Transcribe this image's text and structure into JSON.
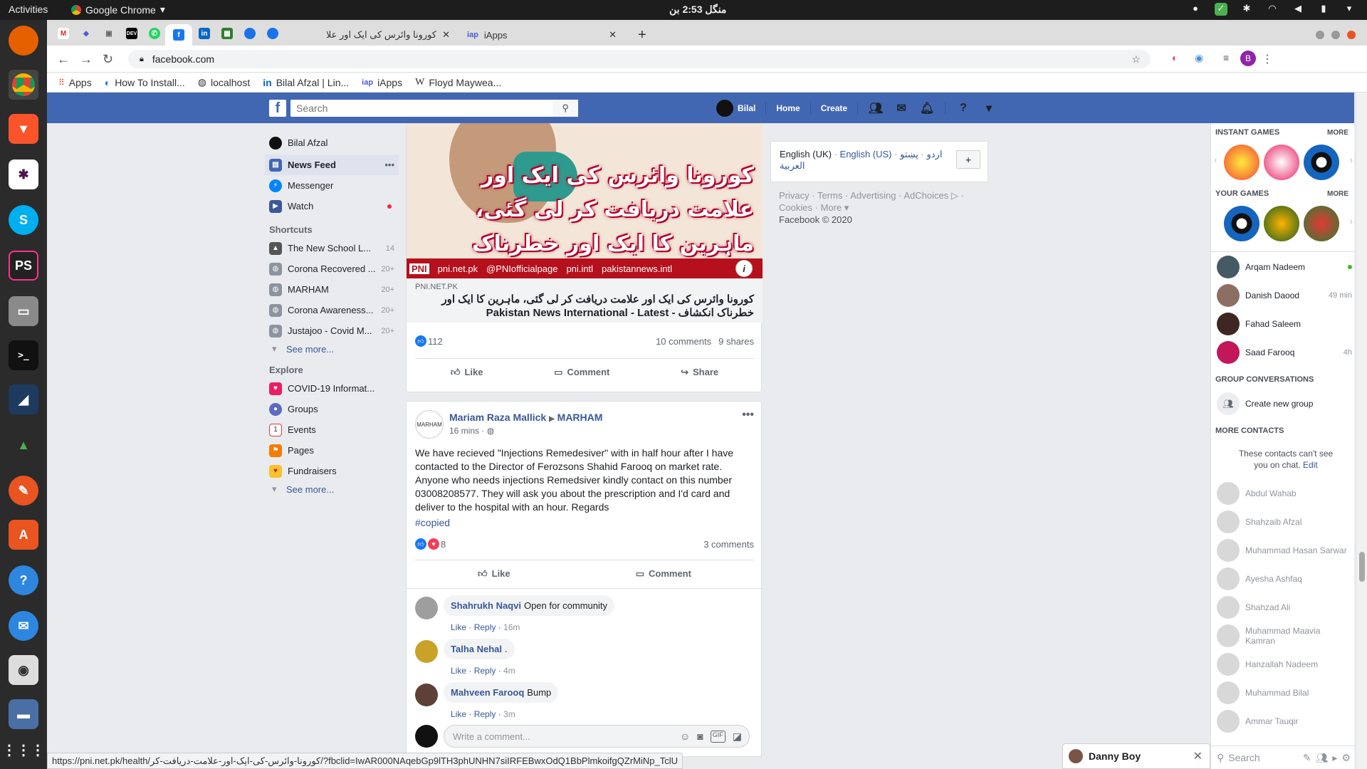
{
  "os": {
    "activities": "Activities",
    "app_name": "Google Chrome",
    "clock": "منگل 2:53 بن"
  },
  "browser": {
    "tabs": [
      {
        "title": "کورونا وائرس کی ایک اور علا",
        "active": true
      },
      {
        "title": "iApps",
        "active": false
      }
    ],
    "url": "facebook.com",
    "bookmarks": [
      {
        "label": "Apps",
        "icon": "apps-grid-icon"
      },
      {
        "label": "How To Install...",
        "icon": "bookmark-icon"
      },
      {
        "label": "localhost",
        "icon": "globe-icon"
      },
      {
        "label": "Bilal Afzal | Lin...",
        "icon": "linkedin-icon"
      },
      {
        "label": "iApps",
        "icon": "iapps-icon"
      },
      {
        "label": "Floyd Maywea...",
        "icon": "wikipedia-icon"
      }
    ],
    "profile_initial": "B",
    "status_url": "https://pni.net.pk/health/کورونا-وائرس-کی-ایک-اور-علامت-دریافت-کر/?fbclid=IwAR000NAqebGp9lTH3phUNHN7siIRFEBwxOdQ1BbPlmkoifgQZrMiNp_TclU"
  },
  "fb": {
    "search_placeholder": "Search",
    "header": {
      "user": "Bilal",
      "home": "Home",
      "create": "Create"
    },
    "leftnav": {
      "user": "Bilal Afzal",
      "main": [
        {
          "label": "News Feed",
          "selected": true
        },
        {
          "label": "Messenger"
        },
        {
          "label": "Watch"
        }
      ],
      "shortcuts_head": "Shortcuts",
      "shortcuts": [
        {
          "label": "The New School L...",
          "count": "14"
        },
        {
          "label": "Corona Recovered ...",
          "count": "20+"
        },
        {
          "label": "MARHAM",
          "count": "20+"
        },
        {
          "label": "Corona Awareness...",
          "count": "20+"
        },
        {
          "label": "Justajoo - Covid M...",
          "count": "20+"
        }
      ],
      "see_more": "See more...",
      "explore_head": "Explore",
      "explore": [
        {
          "label": "COVID-19 Informat..."
        },
        {
          "label": "Groups"
        },
        {
          "label": "Events"
        },
        {
          "label": "Pages"
        },
        {
          "label": "Fundraisers"
        }
      ]
    },
    "post1": {
      "image_headline": "کورونا وائرس کی ایک اور علامت دریافت کر لی گئی، ماہرین کا ایک اور خطرناک انکشاف",
      "image_strip": [
        "PNI",
        "pni.net.pk",
        "@PNIofficialpage",
        "pni.intl",
        "pakistannews.intl"
      ],
      "domain": "PNI.NET.PK",
      "title": "کورونا وائرس کی ایک اور علامت دریافت کر لی گئی، ماہرین کا ایک اور خطرناک انکشاف - Pakistan News International - Latest",
      "likes": "112",
      "comments": "10 comments",
      "shares": "9 shares",
      "actions": [
        "Like",
        "Comment",
        "Share"
      ]
    },
    "post2": {
      "author": "Mariam Raza Mallick",
      "group": "MARHAM",
      "time": "16 mins",
      "body": "We have recieved \"Injections Remedesiver\" with in half hour after I have contacted to the Director of Ferozsons Shahid Farooq on market rate. Anyone who needs injections Remedsiver kindly contact on this number 03008208577. They will ask you about the prescription and I'd card and deliver to the hospital with an hour. Regards",
      "hashtag": "#copied",
      "reactions": "8",
      "comments": "3 comments",
      "actions": [
        "Like",
        "Comment"
      ],
      "comment_list": [
        {
          "name": "Shahrukh Naqvi",
          "text": "Open for community",
          "time": "16m"
        },
        {
          "name": "Talha Nehal",
          "text": ".",
          "time": "4m"
        },
        {
          "name": "Mahveen Farooq",
          "text": "Bump",
          "time": "3m"
        }
      ],
      "comment_like": "Like",
      "comment_reply": "Reply",
      "write_placeholder": "Write a comment..."
    },
    "langs": {
      "current": "English (UK)",
      "others": [
        "English (US)",
        "اردو",
        "پښتو",
        "العربية"
      ]
    },
    "footer": {
      "links": [
        "Privacy",
        "Terms",
        "Advertising",
        "AdChoices",
        "Cookies",
        "More"
      ],
      "copyright": "Facebook © 2020"
    },
    "chat": {
      "instant_games": "INSTANT GAMES",
      "your_games": "YOUR GAMES",
      "more": "MORE",
      "online": [
        {
          "name": "Arqam Nadeem",
          "status": "",
          "online": true
        },
        {
          "name": "Danish Daood",
          "status": "49 min"
        },
        {
          "name": "Fahad Saleem",
          "status": ""
        },
        {
          "name": "Saad Farooq",
          "status": "4h"
        }
      ],
      "group_head": "GROUP CONVERSATIONS",
      "create_group": "Create new group",
      "more_contacts": "MORE CONTACTS",
      "cannot_see": "These contacts can't see you on chat.",
      "edit": "Edit",
      "offline": [
        "Abdul Wahab",
        "Shahzaib Afzal",
        "Muhammad Hasan Sarwar",
        "Ayesha Ashfaq",
        "Shahzad Ali",
        "Muhammad Maavia Kamran",
        "Hanzallah Nadeem",
        "Muhammad Bilal",
        "Ammar Tauqir"
      ],
      "search_placeholder": "Search"
    },
    "chat_tab": "Danny Boy"
  }
}
